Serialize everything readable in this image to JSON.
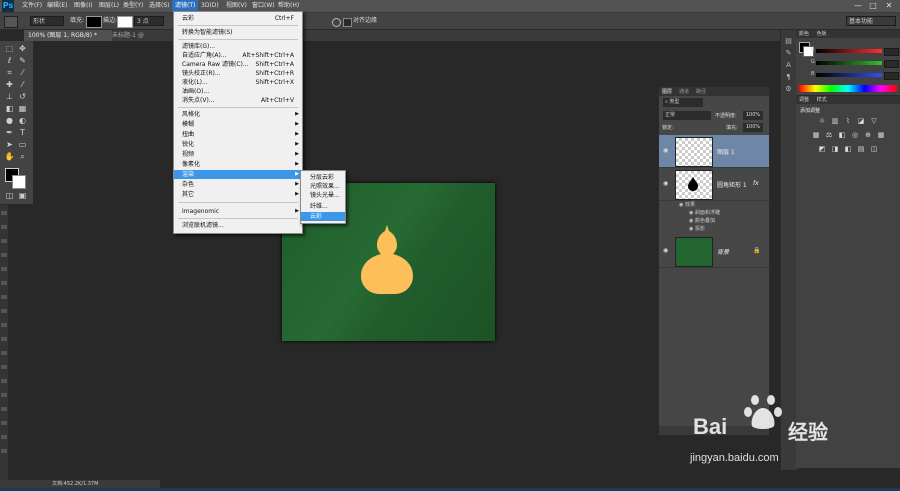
{
  "app": {
    "logo": "Ps"
  },
  "menubar": {
    "items": [
      "文件(F)",
      "编辑(E)",
      "图像(I)",
      "图层(L)",
      "类型(Y)",
      "选择(S)",
      "滤镜(T)",
      "3D(D)",
      "视图(V)",
      "窗口(W)",
      "帮助(H)"
    ],
    "active_index": 6,
    "window_controls": [
      "—",
      "□",
      "✕"
    ]
  },
  "options_bar": {
    "mode": "形状",
    "fill_label": "填充:",
    "stroke_label": "描边:",
    "stroke_size": "3 点",
    "align_edges": "对齐边缘",
    "workspace": "基本功能"
  },
  "tabs": {
    "active": "100% (图层 1, RGB/8) *",
    "inactive": "未标题-1 @"
  },
  "filter_menu": {
    "top": [
      {
        "label": "云彩",
        "shortcut": "Ctrl+F"
      }
    ],
    "smart": [
      {
        "label": "转换为智能滤镜(S)",
        "shortcut": ""
      }
    ],
    "group2": [
      {
        "label": "滤镜库(G)...",
        "shortcut": ""
      },
      {
        "label": "自适应广角(A)...",
        "shortcut": "Alt+Shift+Ctrl+A"
      },
      {
        "label": "Camera Raw 滤镜(C)...",
        "shortcut": "Shift+Ctrl+A"
      },
      {
        "label": "镜头校正(R)...",
        "shortcut": "Shift+Ctrl+R"
      },
      {
        "label": "液化(L)...",
        "shortcut": "Shift+Ctrl+X"
      },
      {
        "label": "油画(O)...",
        "shortcut": ""
      },
      {
        "label": "消失点(V)...",
        "shortcut": "Alt+Ctrl+V"
      }
    ],
    "group3": [
      "风格化",
      "模糊",
      "扭曲",
      "锐化",
      "视频",
      "像素化",
      "渲染",
      "杂色",
      "其它"
    ],
    "highlighted": "渲染",
    "group4": [
      "Imagenomic"
    ],
    "group5": [
      "浏览联机滤镜..."
    ]
  },
  "render_submenu": {
    "items": [
      "分层云彩",
      "光照效果...",
      "镜头光晕...",
      "纤维...",
      "云彩"
    ],
    "highlighted": "云彩"
  },
  "color_panel": {
    "tabs": [
      "颜色",
      "色板"
    ],
    "channels": [
      "R",
      "G",
      "B"
    ],
    "slider_colors": [
      "#ff3030",
      "#30c030",
      "#3050ff"
    ]
  },
  "adjustments_panel": {
    "tabs": [
      "调整",
      "样式"
    ],
    "title": "添加调整"
  },
  "layers_panel": {
    "tabs": [
      "图层",
      "通道",
      "路径"
    ],
    "filter_kind": "类型",
    "blend_mode": "正常",
    "opacity_label": "不透明度:",
    "opacity_value": "100%",
    "lock_label": "锁定:",
    "fill_label": "填充:",
    "fill_value": "100%",
    "layers": [
      {
        "name": "图层 1",
        "selected": true
      },
      {
        "name": "圆角矩形 1",
        "fx": "fx",
        "effects_label": "效果",
        "effects": [
          "斜面和浮雕",
          "颜色叠加",
          "投影"
        ]
      },
      {
        "name": "背景",
        "locked": true
      }
    ]
  },
  "status": {
    "doc": "文档:452.2K/1.37M"
  },
  "canvas": {
    "background_color": "#236530",
    "shape_color": "#fdbf5a"
  },
  "watermark": {
    "brand": "Bai",
    "brand_suffix": "经验",
    "url": "jingyan.baidu.com"
  }
}
